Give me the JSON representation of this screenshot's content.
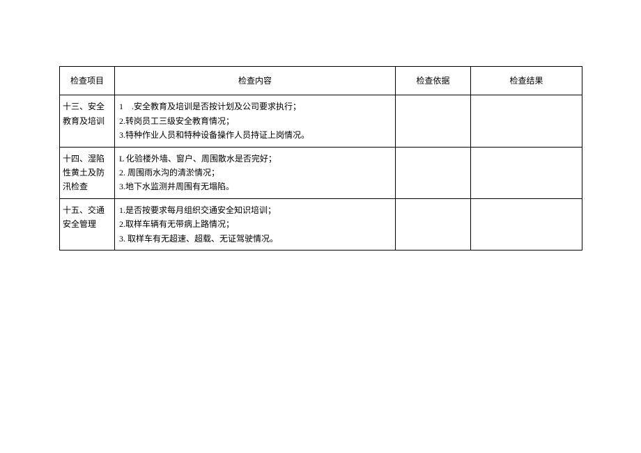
{
  "headers": {
    "item": "检查项目",
    "content": "检查内容",
    "basis": "检查依据",
    "result": "检查结果"
  },
  "rows": [
    {
      "item": "十三、安全教育及培训",
      "content": "1　.安全教育及培训是否按计划及公司要求执行；\n2.转岗员工三级安全教育情况；\n3.特种作业人员和特种设备操作人员持证上岗情况。",
      "basis": "",
      "result": ""
    },
    {
      "item": "十四、湿陷性黄土及防汛检查",
      "content": "L 化验楼外墙、窗户、周围散水是否完好；\n2. 周围雨水沟的清淤情况；\n3.地下水监测井周围有无塌陷。",
      "basis": "",
      "result": ""
    },
    {
      "item": "十五、交通安全管理",
      "content": "1.是否按要求每月组织交通安全知识培训；\n2.取样车辆有无带病上路情况；\n3. 取样车有无超速、超载、无证驾驶情况。",
      "basis": "",
      "result": ""
    }
  ]
}
